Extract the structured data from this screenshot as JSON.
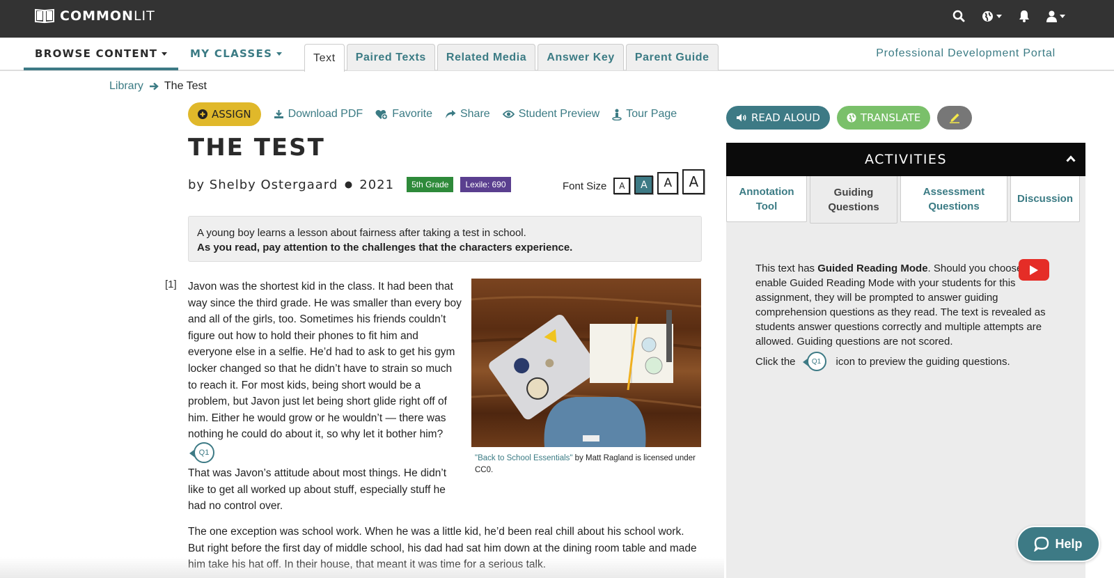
{
  "topbar": {
    "logo_bold": "COMMON",
    "logo_light": "LIT",
    "icons": [
      "search-icon",
      "globe-icon",
      "bell-icon",
      "user-icon"
    ]
  },
  "nav": {
    "browse": "BROWSE CONTENT",
    "classes": "MY CLASSES",
    "tabs": [
      {
        "label": "Text",
        "active": true
      },
      {
        "label": "Paired Texts",
        "active": false
      },
      {
        "label": "Related Media",
        "active": false
      },
      {
        "label": "Answer Key",
        "active": false
      },
      {
        "label": "Parent Guide",
        "active": false
      }
    ],
    "pd_portal": "Professional Development Portal"
  },
  "breadcrumb": {
    "library": "Library",
    "current": "The Test"
  },
  "actions": {
    "assign": "ASSIGN",
    "download": "Download PDF",
    "favorite": "Favorite",
    "share": "Share",
    "preview": "Student Preview",
    "tour": "Tour Page"
  },
  "text": {
    "title": "THE TEST",
    "byline": "by Shelby Ostergaard",
    "year": "2021",
    "grade": "5th Grade",
    "lexile": "Lexile: 690",
    "font_size_label": "Font Size",
    "font_size_letter": "A",
    "intro_line1": "A young boy learns a lesson about fairness after taking a test in school.",
    "intro_line2": "As you read, pay attention to the challenges that the characters experience.",
    "para_number": "[1]",
    "para1": "Javon was the shortest kid in the class. It had been that way since the third grade. He was smaller than every boy and all of the girls, too. Sometimes his friends couldn’t figure out how to hold their phones to fit him and everyone else in a selfie. He’d had to ask to get his gym locker changed so that he didn’t have to strain so much to reach it. For most kids, being short would be a problem, but Javon just let being short glide right off of him. Either he would grow or he wouldn’t — there was nothing he could do about it, so why let it bother him?",
    "q_marker": "Q1",
    "para2": "That was Javon’s attitude about most things. He didn’t like to get all worked up about stuff, especially stuff he had no control over.",
    "para3": "The one exception was school work. When he was a little kid, he’d been real chill about his school work. But right before the first day of middle school, his dad had sat him down at the dining room table and made him take his hat off. In their house, that meant it was time for a serious talk.",
    "caption_link": "\"Back to School Essentials\"",
    "caption_rest": " by Matt Ragland is licensed under CC0."
  },
  "right": {
    "read_aloud": "READ ALOUD",
    "translate": "TRANSLATE",
    "activities": "ACTIVITIES",
    "tabs": [
      {
        "label": "Annotation Tool",
        "active": false
      },
      {
        "label": "Guiding Questions",
        "active": true
      },
      {
        "label": "Assessment Questions",
        "active": false
      },
      {
        "label": "Discussion",
        "active": false
      }
    ],
    "guided_pre": "This text has ",
    "guided_bold": "Guided Reading Mode",
    "guided_post": ". Should you choose to enable Guided Reading Mode with your students for this assignment, they will be prompted to answer guiding comprehension questions as they read. The text is revealed as students answer questions correctly and multiple attempts are allowed. Guiding questions are not scored.",
    "click_pre": "Click the",
    "click_post": "icon to preview the guiding questions.",
    "q_marker": "Q1"
  },
  "help": "Help",
  "colors": {
    "teal": "#3d7a85",
    "assign_yellow": "#e0b82a",
    "translate_green": "#7ac06a",
    "grade_green": "#2e8a3a",
    "lexile_purple": "#5a3f8f",
    "youtube_red": "#e52d27"
  }
}
